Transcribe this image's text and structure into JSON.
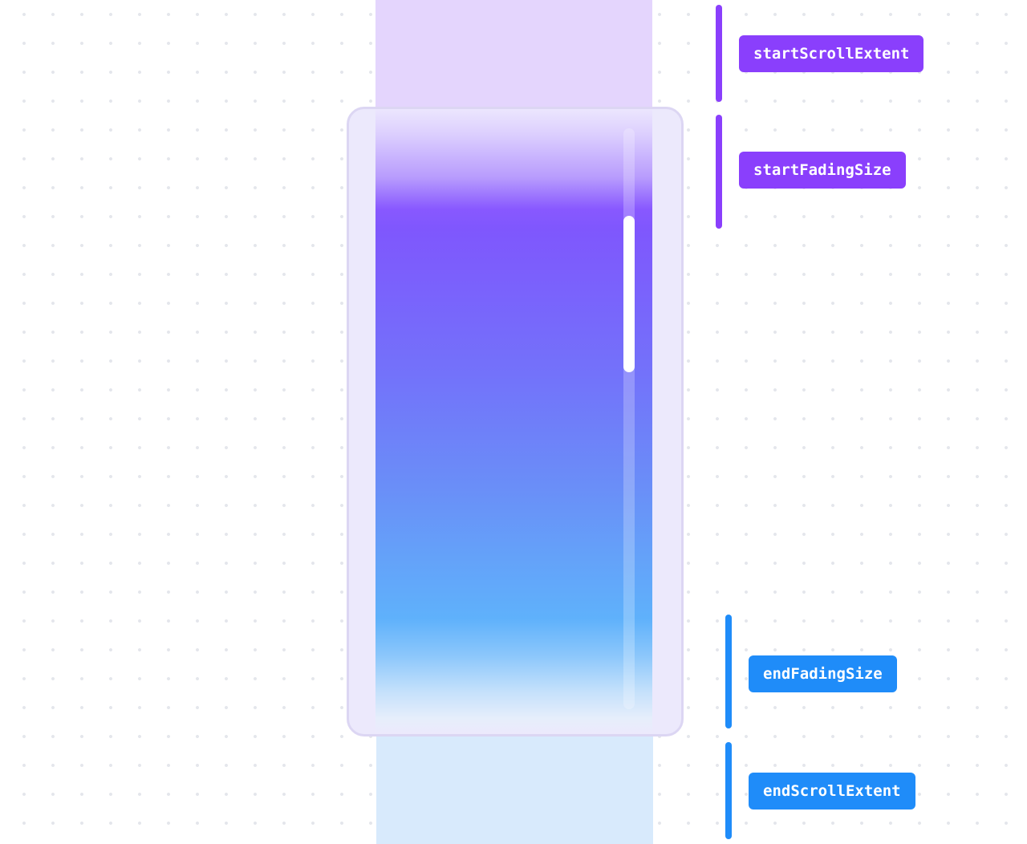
{
  "colors": {
    "purple_accent": "#8a3ffc",
    "blue_accent": "#1f8cf9",
    "top_extent_fill": "#e4d5fd",
    "bottom_extent_fill": "#d8eafc"
  },
  "scrollbar": {
    "thumb_start_fraction": 0.15,
    "thumb_size_fraction": 0.27
  },
  "labels": {
    "start_scroll_extent": "startScrollExtent",
    "start_fading_size": "startFadingSize",
    "end_fading_size": "endFadingSize",
    "end_scroll_extent": "endScrollExtent"
  }
}
